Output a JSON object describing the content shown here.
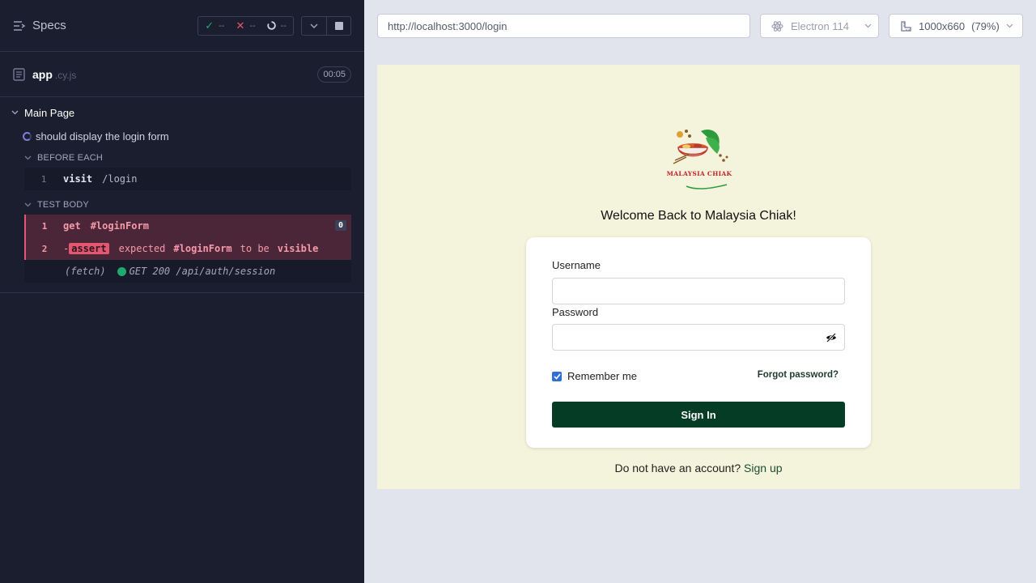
{
  "runner": {
    "specs_label": "Specs",
    "stats": {
      "passed": "--",
      "failed": "--",
      "pending": "--"
    },
    "spec_file": {
      "name": "app",
      "ext": ".cy.js",
      "duration": "00:05"
    },
    "suite": {
      "title": "Main Page",
      "test_title": "should display the login form",
      "before_each_label": "BEFORE EACH",
      "before_each_commands": [
        {
          "num": "1",
          "name": "visit",
          "message": "/login"
        }
      ],
      "test_body_label": "TEST BODY",
      "test_body_commands": [
        {
          "num": "1",
          "name": "get",
          "message": "#loginForm",
          "badge": "0"
        },
        {
          "num": "2",
          "prefix": "-",
          "tag": "assert",
          "w1": "expected",
          "w2": "#loginForm",
          "w3": "to be",
          "w4": "visible"
        }
      ],
      "fetch": {
        "name": "(fetch)",
        "message": "GET 200 /api/auth/session"
      }
    }
  },
  "aut_header": {
    "url": "http://localhost:3000/login",
    "browser": "Electron 114",
    "viewport": "1000x660",
    "zoom": "(79%)"
  },
  "app": {
    "logo_text": "MALAYSIA CHIAK",
    "welcome": "Welcome Back to Malaysia Chiak!",
    "username_label": "Username",
    "password_label": "Password",
    "remember_label": "Remember me",
    "remember_checked": true,
    "forgot_label": "Forgot password?",
    "signin_label": "Sign In",
    "footer_prefix": "Do not have an account?",
    "footer_link": "Sign up"
  },
  "colors": {
    "runner_bg": "#1b1e2e",
    "fail": "#e45770",
    "pass": "#1fa971",
    "app_bg": "#f4f4dc",
    "brand_green": "#053c25"
  },
  "icons": [
    "specs-list-icon",
    "check-icon",
    "x-icon",
    "pending-spinner-icon",
    "chevron-down-icon",
    "stop-icon",
    "document-icon",
    "electron-icon",
    "viewport-ruler-icon",
    "eye-off-icon",
    "checkbox-check-icon"
  ]
}
